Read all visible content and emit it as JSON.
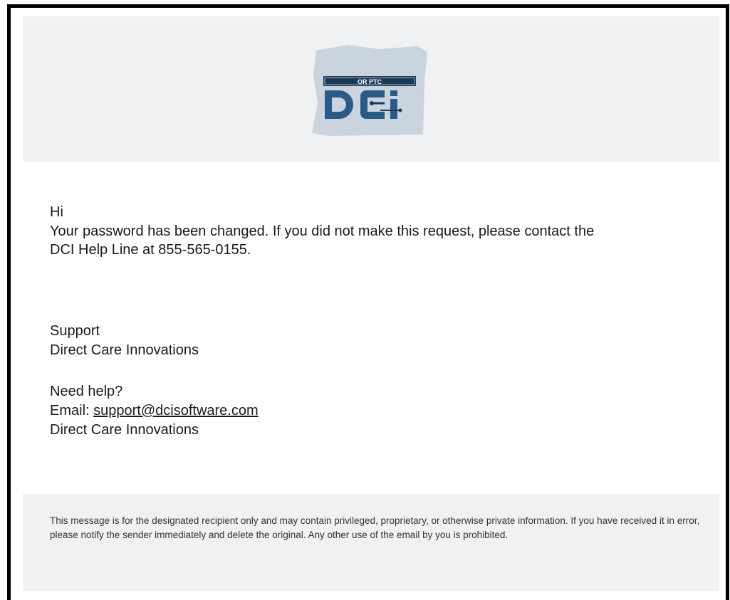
{
  "logo": {
    "banner_text": "OR PTC",
    "brand_text": "DCI",
    "colors": {
      "state_shape": "#c9d4de",
      "banner": "#1c3a57",
      "letters": "#2a5a86"
    }
  },
  "message": {
    "greeting": "Hi",
    "line1": "Your password has been changed. If you did not make this request, please contact the",
    "line2": "DCI Help Line at 855-565-0155.",
    "signoff_name": "Support",
    "signoff_company": "Direct Care Innovations",
    "help_heading": "Need help?",
    "email_label": "Email:",
    "email_address": "support@dcisoftware.com",
    "help_company": "Direct Care Innovations"
  },
  "footer": {
    "disclaimer": "This message is for the designated recipient only and may contain privileged, proprietary, or otherwise private information. If you have received it in error, please notify the sender immediately and delete the original. Any other use of the email by you is prohibited."
  }
}
